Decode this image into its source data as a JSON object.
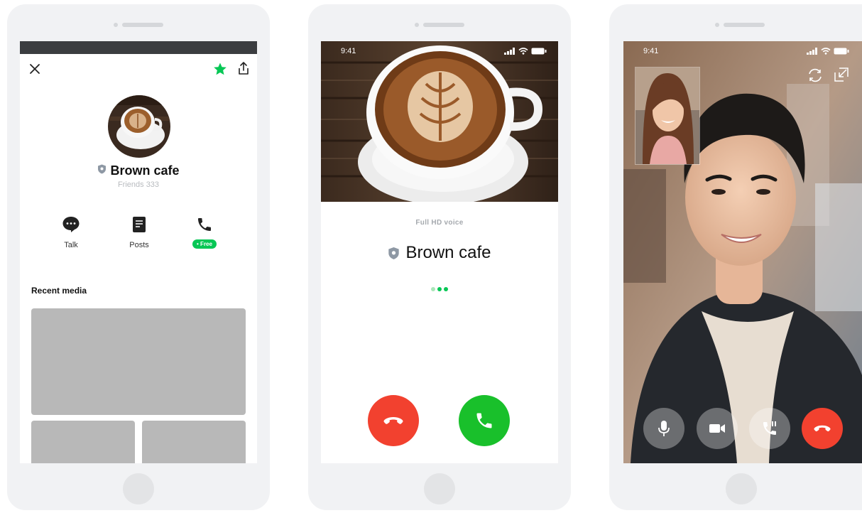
{
  "colors": {
    "line_green": "#06c755",
    "decline_red": "#f2412f",
    "accept_green": "#19c02b",
    "placeholder_gray": "#b8b8b8"
  },
  "profile_screen": {
    "close_icon": "close-icon",
    "favorite_icon": "star-icon",
    "share_icon": "share-icon",
    "account_name": "Brown cafe",
    "friends_label": "Friends 333",
    "actions": [
      {
        "label": "Talk",
        "icon": "chat-bubble-icon"
      },
      {
        "label": "Posts",
        "icon": "document-icon"
      },
      {
        "label": "",
        "icon": "phone-icon",
        "badge": "• Free"
      }
    ],
    "recent_media_title": "Recent media"
  },
  "incoming_call_screen": {
    "status_time": "9:41",
    "voice_quality": "Full HD voice",
    "caller_name": "Brown cafe",
    "decline_icon": "hang-up-icon",
    "accept_icon": "phone-icon"
  },
  "video_call_screen": {
    "status_time": "9:41",
    "switch_camera_icon": "switch-camera-icon",
    "minimize_icon": "minimize-icon",
    "controls": [
      "microphone-icon",
      "video-camera-icon",
      "mute-call-icon",
      "hang-up-icon"
    ]
  }
}
